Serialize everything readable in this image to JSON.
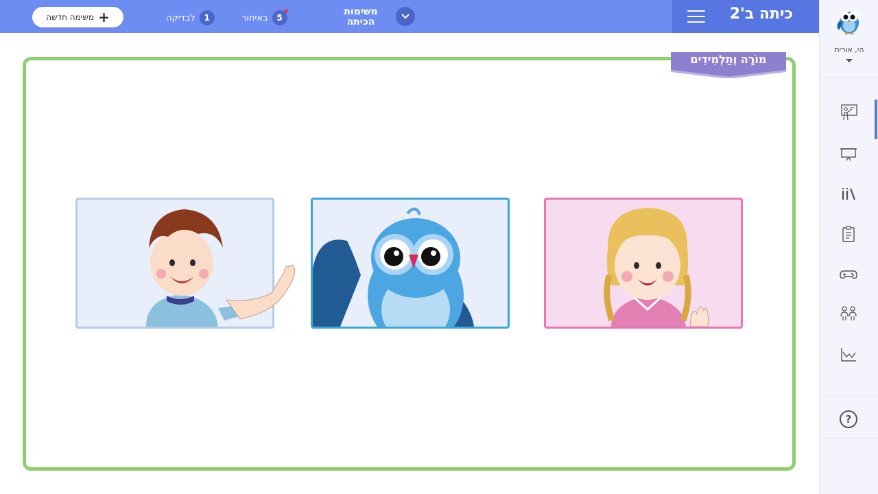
{
  "header": {
    "class_title": "כיתה ב'2",
    "menu_icon": "hamburger-icon",
    "tasks_dropdown": {
      "label": "משימות הכיתה",
      "icon": "chevron-down-icon"
    },
    "late": {
      "count": "5",
      "label": "באיחור",
      "has_alert": true
    },
    "to_check": {
      "count": "1",
      "label": "לבדיקה"
    },
    "new_task": {
      "label": "משימה חדשה",
      "icon": "plus-icon"
    }
  },
  "sidebar": {
    "logo": "owl-logo",
    "greeting": "הי, אורית",
    "items": [
      {
        "icon": "teacher-board-icon",
        "active": true
      },
      {
        "icon": "presentation-icon",
        "active": false
      },
      {
        "icon": "library-icon",
        "active": false
      },
      {
        "icon": "clipboard-icon",
        "active": false
      },
      {
        "icon": "gamepad-icon",
        "active": false
      },
      {
        "icon": "students-icon",
        "active": false
      },
      {
        "icon": "chart-icon",
        "active": false
      }
    ],
    "help": "?"
  },
  "board": {
    "ribbon_title": "מוֹרָה וְתַלְמִידִים",
    "frames": [
      "boy",
      "owl",
      "girl"
    ]
  },
  "colors": {
    "topbar": "#6e8df2",
    "class_tab": "#5776e2",
    "board_border": "#8dcf6e",
    "ribbon": "#8e80cf"
  }
}
